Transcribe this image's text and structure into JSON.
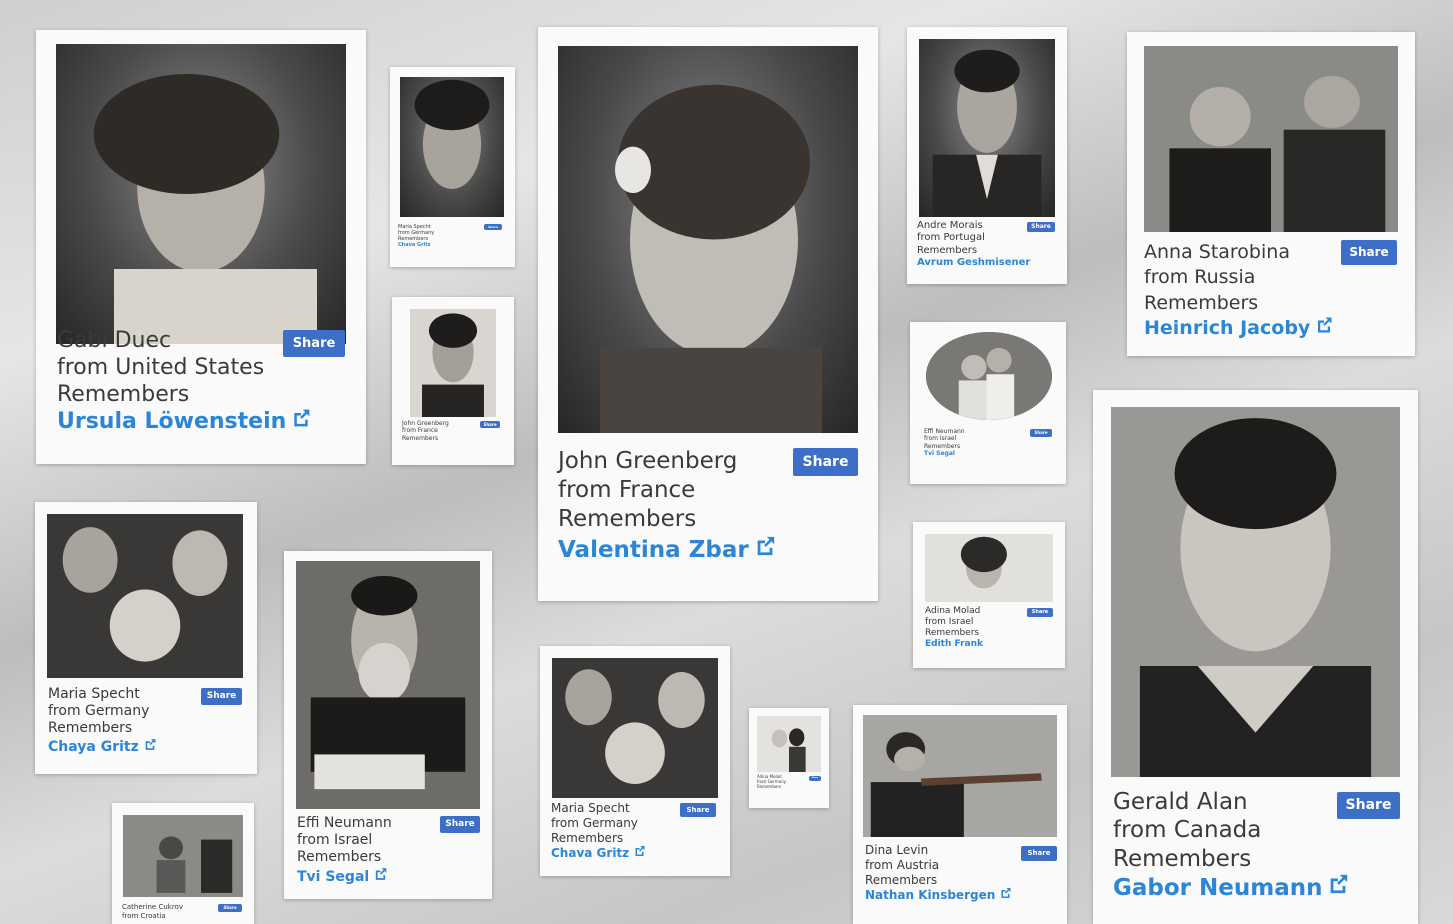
{
  "cards": {
    "c1": {
      "author": "Gabi Duec",
      "origin": "from United States",
      "verb": "Remembers",
      "name": "Ursula Löwenstein",
      "share": "Share"
    },
    "c2": {
      "author": "Maria Specht",
      "origin": "from Germany",
      "verb": "Remembers",
      "name": "Chava Gritz",
      "share": "Share"
    },
    "c3": {
      "author": "John Greenberg",
      "origin": "from France",
      "verb": "Remembers",
      "name": "",
      "share": "Share"
    },
    "c4": {
      "author": "John Greenberg",
      "origin": "from France",
      "verb": "Remembers",
      "name": "Valentina Zbar",
      "share": "Share"
    },
    "c5": {
      "author": "Andre Morais",
      "origin": "from Portugal",
      "verb": "Remembers",
      "name": "Avrum Geshmisener",
      "share": "Share"
    },
    "c6": {
      "author": "Anna Starobina",
      "origin": "from Russia",
      "verb": "Remembers",
      "name": "Heinrich Jacoby",
      "share": "Share"
    },
    "c7": {
      "author": "Effi Neumann",
      "origin": "from Israel",
      "verb": "Remembers",
      "name": "Tvi Segal",
      "share": "Share"
    },
    "c8": {
      "author": "Adina Molad",
      "origin": "from Israel",
      "verb": "Remembers",
      "name": "Edith Frank",
      "share": "Share"
    },
    "c9": {
      "author": "Gerald Alan",
      "origin": "from Canada",
      "verb": "Remembers",
      "name": "Gabor Neumann",
      "share": "Share"
    },
    "c10": {
      "author": "Maria Specht",
      "origin": "from Germany",
      "verb": "Remembers",
      "name": "Chaya Gritz",
      "share": "Share"
    },
    "c11": {
      "author": "Effi Neumann",
      "origin": "from Israel",
      "verb": "Remembers",
      "name": "Tvi Segal",
      "share": "Share"
    },
    "c12": {
      "author": "Maria Specht",
      "origin": "from Germany",
      "verb": "Remembers",
      "name": "Chava Gritz",
      "share": "Share"
    },
    "c13": {
      "author": "Adina Molad",
      "origin": "from Germany",
      "verb": "Remembers",
      "name": "",
      "share": "Share"
    },
    "c14": {
      "author": "Dina Levin",
      "origin": "from Austria",
      "verb": "Remembers",
      "name": "Nathan Kinsbergen",
      "share": "Share"
    },
    "c15": {
      "author": "Catherine Cukrov",
      "origin": "from Croatia",
      "verb": "",
      "name": "",
      "share": "Share"
    }
  },
  "colors": {
    "link": "#2c86d6",
    "share_bg": "#3d6fc6",
    "card_bg": "#fafafb"
  },
  "icons": {
    "external_link": "external-link-icon"
  }
}
